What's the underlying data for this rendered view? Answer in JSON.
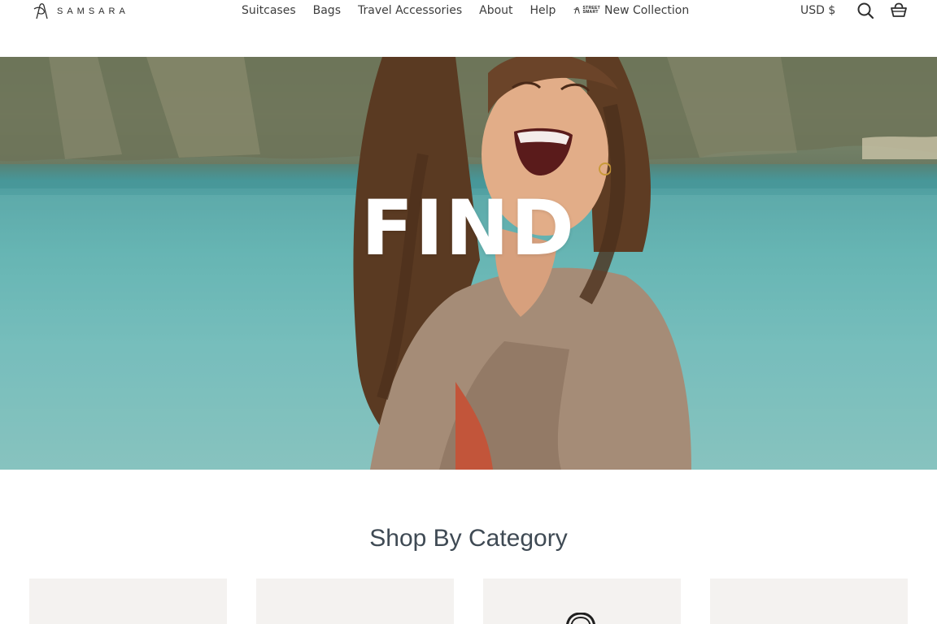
{
  "brand": {
    "name": "SAMSARA",
    "logo_icon": "samsara-logo-icon"
  },
  "nav": {
    "items": [
      {
        "label": "Suitcases"
      },
      {
        "label": "Bags"
      },
      {
        "label": "Travel Accessories"
      },
      {
        "label": "About"
      },
      {
        "label": "Help"
      },
      {
        "label": "New Collection",
        "badge_line1": "STREET",
        "badge_line2": "SMART"
      }
    ]
  },
  "header": {
    "currency": "USD $",
    "search_icon": "search-icon",
    "cart_icon": "basket-icon"
  },
  "hero": {
    "headline": "FIND"
  },
  "shop_by_category": {
    "title": "Shop By Category",
    "cards": [
      {
        "id": "category-1"
      },
      {
        "id": "category-2"
      },
      {
        "id": "category-3",
        "icon": "bag-handle-icon"
      },
      {
        "id": "category-4"
      }
    ]
  },
  "colors": {
    "text": "#3d3d3d",
    "heading": "#3f4a54",
    "card_bg": "#f4f2f0"
  }
}
